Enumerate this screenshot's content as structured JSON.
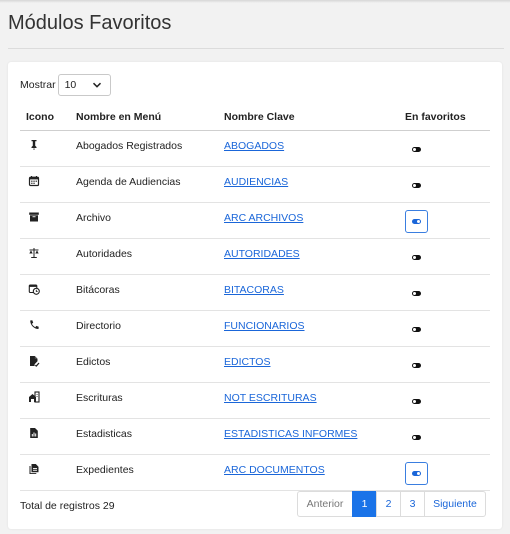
{
  "page": {
    "title": "Módulos Favoritos"
  },
  "length": {
    "label": "Mostrar",
    "value": "10"
  },
  "table": {
    "headers": {
      "icon": "Icono",
      "name": "Nombre en Menú",
      "key": "Nombre Clave",
      "fav": "En favoritos"
    },
    "rows": [
      {
        "icon": "gavel-icon",
        "name": "Abogados Registrados",
        "key": "ABOGADOS",
        "favorite": false
      },
      {
        "icon": "calendar-icon",
        "name": "Agenda de Audiencias",
        "key": "AUDIENCIAS",
        "favorite": false
      },
      {
        "icon": "archive-box-icon",
        "name": "Archivo",
        "key": "ARC ARCHIVOS",
        "favorite": true
      },
      {
        "icon": "balance-scale-icon",
        "name": "Autoridades",
        "key": "AUTORIDADES",
        "favorite": false
      },
      {
        "icon": "calendar-clock-icon",
        "name": "Bitácoras",
        "key": "BITACORAS",
        "favorite": false
      },
      {
        "icon": "phone-icon",
        "name": "Directorio",
        "key": "FUNCIONARIOS",
        "favorite": false
      },
      {
        "icon": "file-sign-icon",
        "name": "Edictos",
        "key": "EDICTOS",
        "favorite": false
      },
      {
        "icon": "home-work-icon",
        "name": "Escrituras",
        "key": "NOT ESCRITURAS",
        "favorite": false
      },
      {
        "icon": "file-chart-icon",
        "name": "Estadisticas",
        "key": "ESTADISTICAS INFORMES",
        "favorite": false
      },
      {
        "icon": "file-copy-icon",
        "name": "Expedientes",
        "key": "ARC DOCUMENTOS",
        "favorite": true
      }
    ]
  },
  "footer": {
    "total": "Total de registros 29"
  },
  "pagination": {
    "previous": "Anterior",
    "pages": [
      "1",
      "2",
      "3"
    ],
    "active": "1",
    "next": "Siguiente"
  },
  "colors": {
    "link": "#1a66d9",
    "active_page": "#1a73e8"
  }
}
